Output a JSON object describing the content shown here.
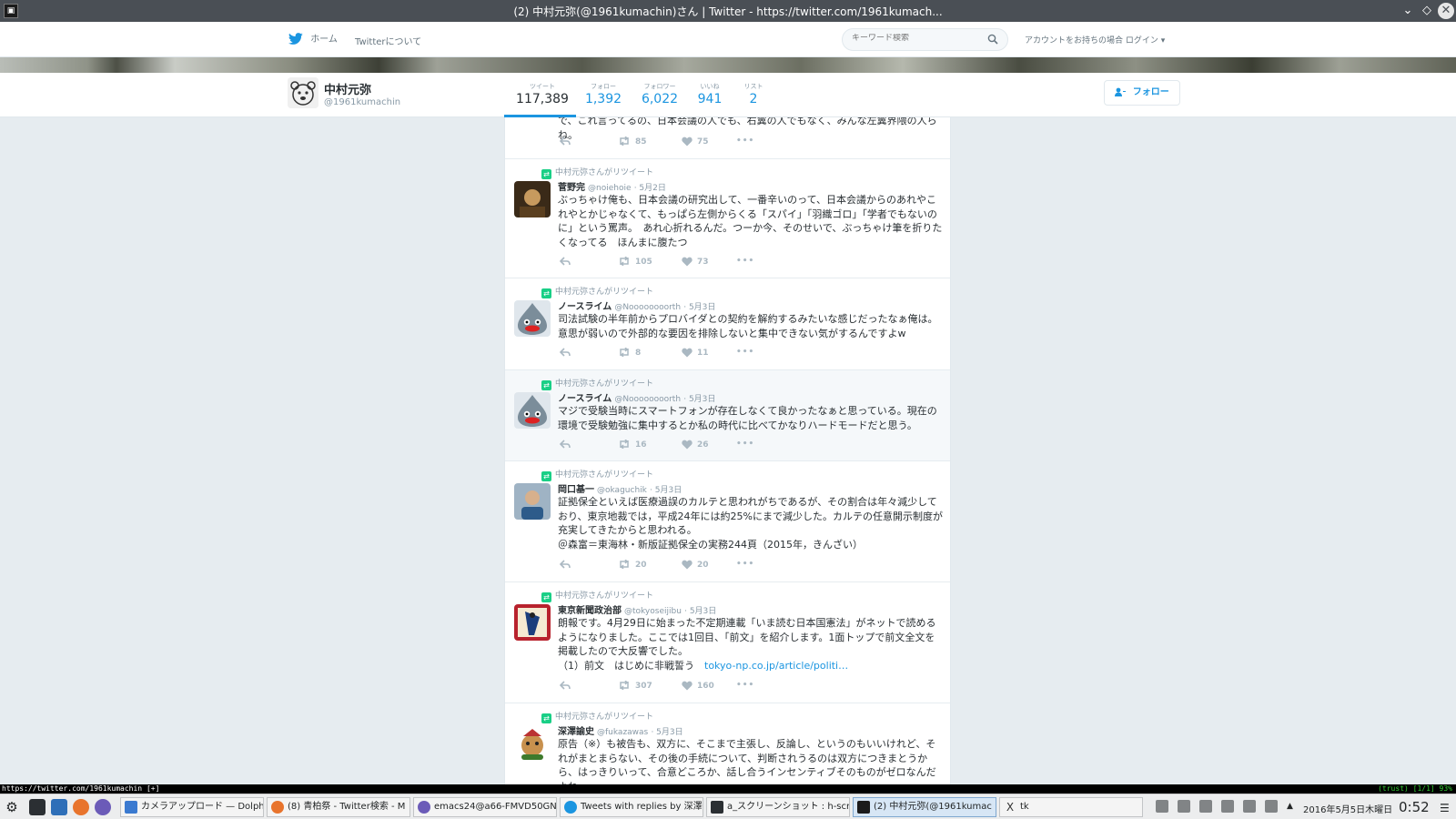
{
  "window": {
    "title": "(2) 中村元弥(@1961kumachin)さん | Twitter - https://twitter.com/1961kumach...",
    "app_icon": "terminal-icon"
  },
  "topnav": {
    "home_label": "ホーム",
    "about_label": "Twitterについて",
    "search_placeholder": "キーワード検索",
    "login_text": "アカウントをお持ちの場合 ログイン ▾"
  },
  "profile": {
    "name": "中村元弥",
    "handle": "@1961kumachin",
    "stats": [
      {
        "label": "ツイート",
        "value": "117,389"
      },
      {
        "label": "フォロー",
        "value": "1,392"
      },
      {
        "label": "フォロワー",
        "value": "6,022"
      },
      {
        "label": "いいね",
        "value": "941"
      },
      {
        "label": "リスト",
        "value": "2"
      }
    ],
    "follow_label": "フォロー"
  },
  "tweets": [
    {
      "context": "",
      "name": "",
      "handle": "",
      "time": "",
      "text": "で、これ言ってるの、日本会議の人でも、右翼の人でもなく、みんな左翼界隈の人らね。",
      "retweets": "85",
      "likes": "75"
    },
    {
      "context": "中村元弥さんがリツイート",
      "name": "菅野完",
      "handle": "@noiehoie",
      "time": "· 5月2日",
      "text": "ぶっちゃけ俺も、日本会議の研究出して、一番辛いのって、日本会議からのあれやこれやとかじゃなくて、もっぱら左側からくる「スパイ」「羽織ゴロ」「学者でもないのに」という罵声。　あれ心折れるんだ。つーか今、そのせいで、ぶっちゃけ筆を折りたくなってる　ほんまに腹たつ",
      "retweets": "105",
      "likes": "73"
    },
    {
      "context": "中村元弥さんがリツイート",
      "name": "ノースライム",
      "handle": "@Noooooooorth",
      "time": "· 5月3日",
      "text": "司法試験の半年前からプロバイダとの契約を解約するみたいな感じだったなぁ俺は。意思が弱いので外部的な要因を排除しないと集中できない気がするんですよw",
      "retweets": "8",
      "likes": "11"
    },
    {
      "context": "中村元弥さんがリツイート",
      "name": "ノースライム",
      "handle": "@Noooooooorth",
      "time": "· 5月3日",
      "text": "マジで受験当時にスマートフォンが存在しなくて良かったなぁと思っている。現在の環境で受験勉強に集中するとか私の時代に比べてかなりハードモードだと思う。",
      "retweets": "16",
      "likes": "26"
    },
    {
      "context": "中村元弥さんがリツイート",
      "name": "岡口基一",
      "handle": "@okaguchik",
      "time": "· 5月3日",
      "text": "証拠保全といえば医療過誤のカルテと思われがちであるが、その割合は年々減少しており、東京地裁では，平成24年には約25%にまで減少した。カルテの任意開示制度が充実してきたからと思われる。\n＠森富＝東海林・新版証拠保全の実務244頁（2015年，きんざい）",
      "retweets": "20",
      "likes": "20"
    },
    {
      "context": "中村元弥さんがリツイート",
      "name": "東京新聞政治部",
      "handle": "@tokyoseijibu",
      "time": "· 5月3日",
      "text": "朗報です。4月29日に始まった不定期連載「いま読む日本国憲法」がネットで読めるようになりました。ここでは1回目、「前文」を紹介します。1面トップで前文全文を掲載したので大反響でした。\n（1）前文　はじめに非戦誓う　",
      "link": "tokyo-np.co.jp/article/politi…",
      "retweets": "307",
      "likes": "160"
    },
    {
      "context": "中村元弥さんがリツイート",
      "name": "深澤諭史",
      "handle": "@fukazawas",
      "time": "· 5月3日",
      "text": "原告（※）も被告も、双方に、そこまで主張し、反論し、というのもいいけれど、それがまとまらない、その後の手続について、判断されうるのは双方につきまとうから、はっきりいって、合意どころか、話し合うインセンティブそのものがゼロなんだよね。",
      "retweets": "",
      "likes": ""
    }
  ],
  "statusline": {
    "url": "https://twitter.com/1961kumachin [+]",
    "trust": "(trust) [1/1] 93%"
  },
  "taskbar": {
    "tasks": [
      "カメラアップロード — Dolphin",
      "(8) 青柏祭 - Twitter検索 - M",
      "emacs24@a66-FMVD50GN",
      "Tweets with replies by 深澤",
      "a_スクリーンショット : h-scrot",
      "(2) 中村元弥(@1961kumac",
      "tk"
    ],
    "date": "2016年5月5日木曜日",
    "time": "0:52"
  },
  "colors": {
    "twitter_blue": "#1b95e0",
    "retweet_green": "#19cf86",
    "background": "#e6ecf0"
  }
}
